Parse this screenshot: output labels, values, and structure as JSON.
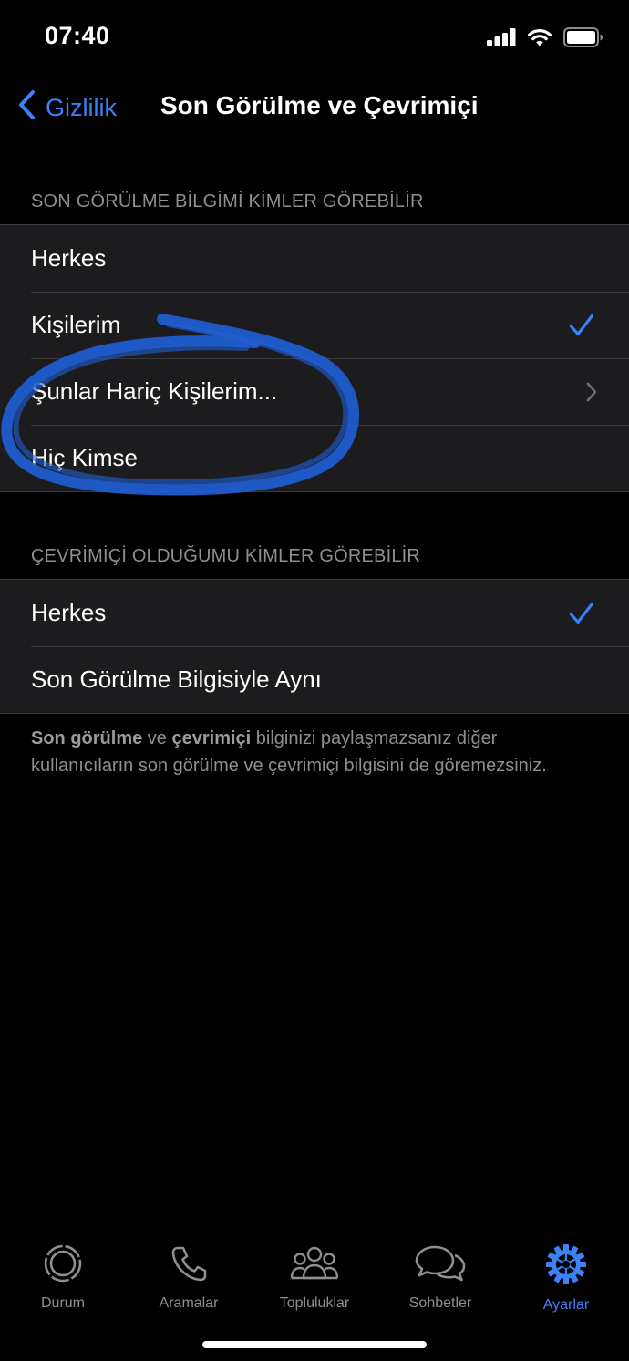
{
  "status_bar": {
    "time": "07:40"
  },
  "nav": {
    "back_label": "Gizlilik",
    "title": "Son Görülme ve Çevrimiçi"
  },
  "last_seen": {
    "header": "SON GÖRÜLME BİLGİMİ KİMLER GÖREBİLİR",
    "options": [
      {
        "label": "Herkes",
        "selected": false
      },
      {
        "label": "Kişilerim",
        "selected": true
      },
      {
        "label": "Şunlar Hariç Kişilerim...",
        "selected": false,
        "has_chevron": true
      },
      {
        "label": "Hiç Kimse",
        "selected": false
      }
    ]
  },
  "online": {
    "header": "ÇEVRİMİÇİ OLDUĞUMU KİMLER GÖREBİLİR",
    "options": [
      {
        "label": "Herkes",
        "selected": true
      },
      {
        "label": "Son Görülme Bilgisiyle Aynı",
        "selected": false
      }
    ]
  },
  "footer": {
    "bold1": "Son görülme",
    "text1": " ve ",
    "bold2": "çevrimiçi",
    "text2": " bilginizi paylaşmazsanız diğer kullanıcıların son görülme ve çevrimiçi bilgisini de göremezsiniz."
  },
  "tabs": [
    {
      "label": "Durum",
      "icon": "status-icon",
      "active": false
    },
    {
      "label": "Aramalar",
      "icon": "phone-icon",
      "active": false
    },
    {
      "label": "Topluluklar",
      "icon": "communities-icon",
      "active": false
    },
    {
      "label": "Sohbetler",
      "icon": "chats-icon",
      "active": false
    },
    {
      "label": "Ayarlar",
      "icon": "settings-gear-icon",
      "active": true
    }
  ],
  "colors": {
    "accent": "#3b82f6",
    "background": "#000000",
    "cell": "#1c1c1e",
    "secondary_text": "#8e8e93",
    "annotation": "#1f5fd6"
  }
}
